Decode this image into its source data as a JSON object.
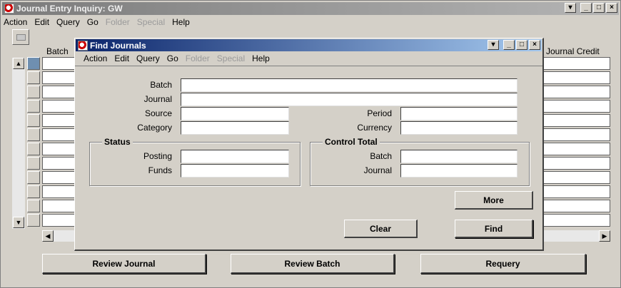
{
  "main_window": {
    "title": "Journal Entry Inquiry: GW",
    "menu": [
      {
        "label": "Action",
        "key": "A",
        "enabled": true
      },
      {
        "label": "Edit",
        "key": "E",
        "enabled": true
      },
      {
        "label": "Query",
        "key": "Q",
        "enabled": true
      },
      {
        "label": "Go",
        "key": "G",
        "enabled": true
      },
      {
        "label": "Folder",
        "key": "",
        "enabled": false
      },
      {
        "label": "Special",
        "key": "",
        "enabled": false
      },
      {
        "label": "Help",
        "key": "H",
        "enabled": true
      }
    ],
    "columns": {
      "batch": "Batch",
      "journal_credit": "Journal Credit"
    },
    "buttons": {
      "review_journal": "Review Journal",
      "review_batch": "Review Batch",
      "requery": "Requery"
    },
    "icons": {
      "toolbar": "folder-icon"
    }
  },
  "find_dialog": {
    "title": "Find Journals",
    "menu": [
      {
        "label": "Action",
        "enabled": true
      },
      {
        "label": "Edit",
        "enabled": true
      },
      {
        "label": "Query",
        "enabled": true
      },
      {
        "label": "Go",
        "enabled": true
      },
      {
        "label": "Folder",
        "enabled": false
      },
      {
        "label": "Special",
        "enabled": false
      },
      {
        "label": "Help",
        "enabled": true
      }
    ],
    "fields": {
      "batch": {
        "label": "Batch",
        "value": ""
      },
      "journal": {
        "label": "Journal",
        "value": ""
      },
      "source": {
        "label": "Source",
        "value": ""
      },
      "category": {
        "label": "Category",
        "value": ""
      },
      "period": {
        "label": "Period",
        "value": ""
      },
      "currency": {
        "label": "Currency",
        "value": ""
      }
    },
    "status_group": {
      "title": "Status",
      "posting": {
        "label": "Posting",
        "value": ""
      },
      "funds": {
        "label": "Funds",
        "value": ""
      }
    },
    "control_group": {
      "title": "Control Total",
      "batch": {
        "label": "Batch",
        "value": ""
      },
      "journal": {
        "label": "Journal",
        "value": ""
      }
    },
    "buttons": {
      "more": "More",
      "clear": "Clear",
      "find": "Find"
    }
  },
  "colors": {
    "inactive_title": "#7b7b7b",
    "active_title": "#0a246a",
    "face": "#d4d0c8"
  }
}
